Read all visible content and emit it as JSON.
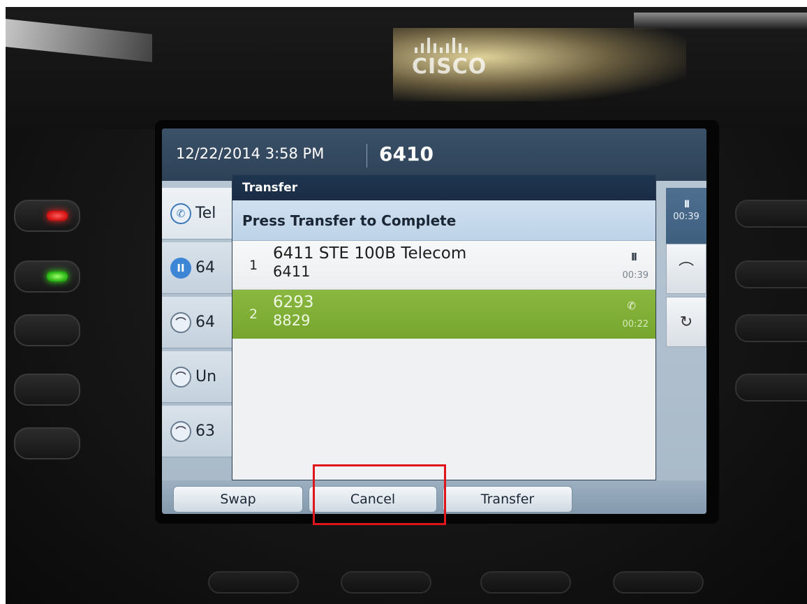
{
  "brand": {
    "logo_text": "CISCO"
  },
  "header": {
    "datetime": "12/22/2014 3:58 PM",
    "extension": "6410"
  },
  "lines": [
    {
      "label": "Tel",
      "icon": "phone-ringing-icon"
    },
    {
      "label": "64",
      "icon": "hold-icon"
    },
    {
      "label": "64",
      "icon": "handset-icon"
    },
    {
      "label": "Un",
      "icon": "handset-icon"
    },
    {
      "label": "63",
      "icon": "handset-icon"
    }
  ],
  "right_panel": {
    "timer": "00:39",
    "pause_glyph": "II"
  },
  "dialog": {
    "title": "Transfer",
    "prompt": "Press Transfer to Complete",
    "calls": [
      {
        "index": "1",
        "primary": "6411 STE 100B Telecom",
        "secondary": "6411",
        "status_icon": "hold-icon",
        "status_glyph": "II",
        "timer": "00:39"
      },
      {
        "index": "2",
        "primary": "6293",
        "secondary": "8829",
        "status_icon": "active-call-icon",
        "status_glyph": "✆",
        "timer": "00:22"
      }
    ]
  },
  "softkeys": {
    "swap": "Swap",
    "cancel": "Cancel",
    "transfer": "Transfer"
  },
  "colors": {
    "highlight": "#e0151b",
    "active_call": "#8ab73f",
    "dialog_title_bg": "#1f3550",
    "hold_blue": "#3d86d6"
  }
}
